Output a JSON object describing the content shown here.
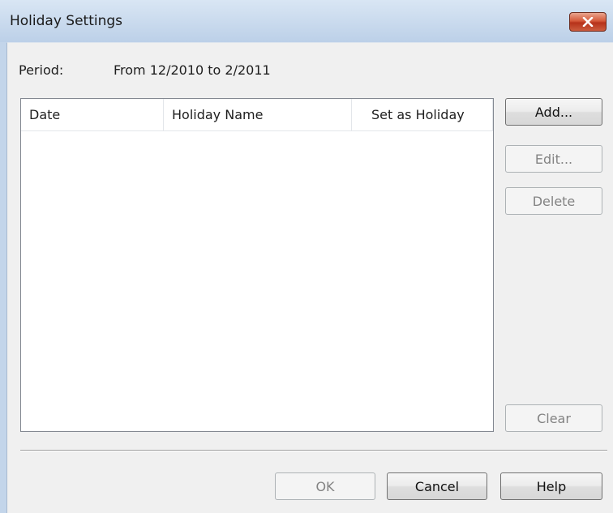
{
  "window": {
    "title": "Holiday Settings",
    "close_icon": "close-icon",
    "accent_color": "#c3d5ea",
    "close_color": "#c9452b"
  },
  "period": {
    "label": "Period:",
    "value": "From 12/2010 to 2/2011"
  },
  "holiday_list": {
    "columns": [
      "Date",
      "Holiday Name",
      "Set as Holiday"
    ],
    "rows": []
  },
  "side_buttons": {
    "add": "Add...",
    "edit": "Edit...",
    "delete": "Delete",
    "clear": "Clear"
  },
  "footer_buttons": {
    "ok": "OK",
    "cancel": "Cancel",
    "help": "Help"
  }
}
